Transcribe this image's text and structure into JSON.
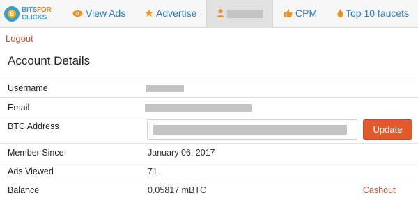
{
  "brand": {
    "logo_line1": "BITS",
    "logo_line1_accent": "FOR",
    "logo_line2": "CLICKS",
    "coin_glyph": "B",
    "colors": {
      "blue": "#3a9fc4",
      "orange": "#e08a1e"
    }
  },
  "nav": {
    "items": [
      {
        "label": "View Ads",
        "icon": "eye-icon"
      },
      {
        "label": "Advertise",
        "icon": "star-icon"
      },
      {
        "label": "",
        "icon": "user-icon",
        "redacted": true
      },
      {
        "label": "CPM",
        "icon": "thumbs-up-icon"
      },
      {
        "label": "Top 10 faucets",
        "icon": "drop-icon"
      }
    ],
    "colors": {
      "link": "#2f7db3",
      "icon": "#e8932a"
    }
  },
  "logout_label": "Logout",
  "page_title": "Account Details",
  "details": {
    "username": {
      "label": "Username",
      "value": "",
      "redacted": true
    },
    "email": {
      "label": "Email",
      "value": "",
      "redacted": true
    },
    "btc_address": {
      "label": "BTC Address",
      "value": "",
      "redacted": true,
      "button_label": "Update"
    },
    "member_since": {
      "label": "Member Since",
      "value": "January 06, 2017"
    },
    "ads_viewed": {
      "label": "Ads Viewed",
      "value": "71"
    },
    "balance": {
      "label": "Balance",
      "value": "0.05817 mBTC",
      "action_label": "Cashout"
    }
  },
  "colors": {
    "accent": "#e05a2b",
    "link_red": "#c0502d"
  }
}
